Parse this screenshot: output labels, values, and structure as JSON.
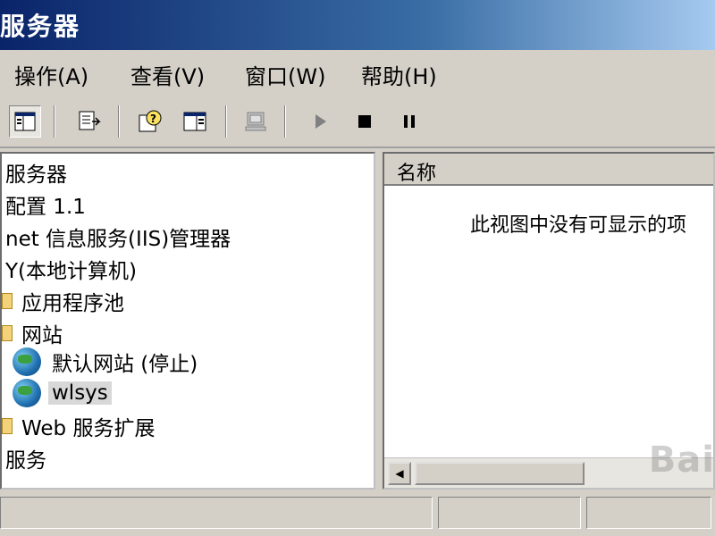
{
  "window": {
    "title": "服务器"
  },
  "menu": [
    {
      "label": "操作(A)"
    },
    {
      "label": "查看(V)"
    },
    {
      "label": "窗口(W)"
    },
    {
      "label": "帮助(H)"
    }
  ],
  "toolbar_icons": [
    "back-forward-icon",
    "show-hide-tree-icon",
    "export-list-icon",
    "help-icon",
    "properties-pane-icon",
    "computer-icon",
    "play-icon",
    "stop-icon",
    "pause-icon"
  ],
  "tree": {
    "items": [
      {
        "label": "服务器"
      },
      {
        "label": "配置 1.1"
      },
      {
        "label": "net 信息服务(IIS)管理器"
      },
      {
        "label": "Y(本地计算机)"
      },
      {
        "label": "应用程序池"
      },
      {
        "label": "网站"
      },
      {
        "label": "默认网站 (停止)"
      },
      {
        "label": "wlsys"
      },
      {
        "label": "Web 服务扩展"
      },
      {
        "label": "服务"
      }
    ]
  },
  "list": {
    "column_header": "名称",
    "empty_message": "此视图中没有可显示的项"
  },
  "watermark": "Bai"
}
